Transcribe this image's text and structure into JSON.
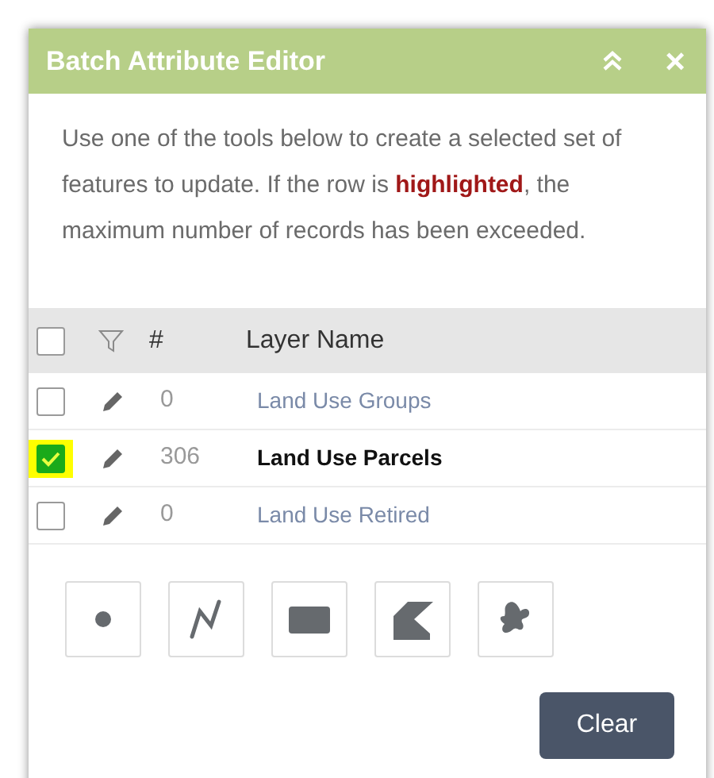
{
  "window": {
    "title": "Batch Attribute Editor",
    "close_button": "×"
  },
  "instructions": "Use one of the tools below to create a selected set of features to update. If the row is **highlighted**, the maximum number of records has been exceeded.",
  "table": {
    "header": {
      "checked": false,
      "count_label": "#",
      "name_label": "Layer Name"
    },
    "rows": [
      {
        "checked": false,
        "selected": false,
        "annotated": false,
        "count": "0",
        "name": "Land Use Groups"
      },
      {
        "checked": true,
        "selected": true,
        "annotated": true,
        "count": "306",
        "name": "Land Use Parcels"
      },
      {
        "checked": false,
        "selected": false,
        "annotated": false,
        "count": "0",
        "name": "Land Use Retired"
      }
    ]
  },
  "tools": [
    {
      "kind": "point"
    },
    {
      "kind": "polyline"
    },
    {
      "kind": "rectangle"
    },
    {
      "kind": "polygon"
    },
    {
      "kind": "freehand"
    }
  ],
  "clear_button": "Clear"
}
